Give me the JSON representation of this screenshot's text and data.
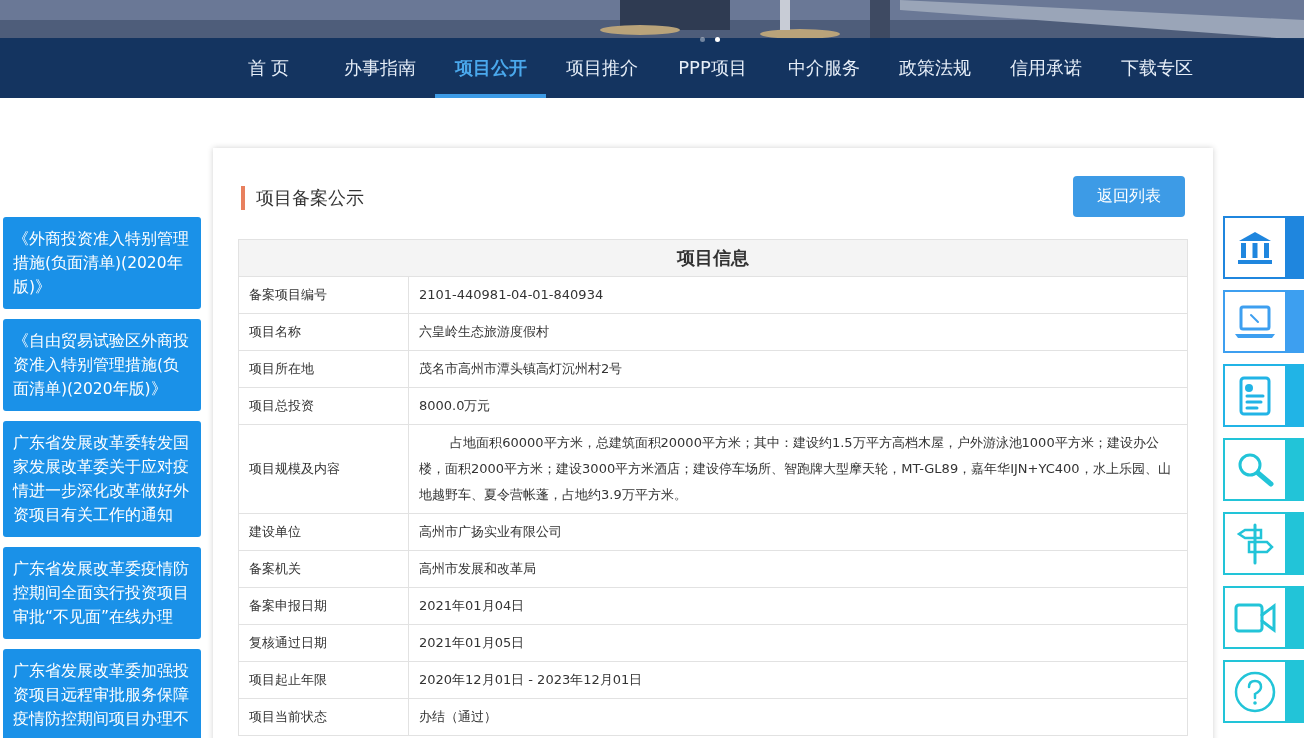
{
  "banner": {
    "kind": "picture",
    "slides": [
      {
        "selected": false
      },
      {
        "selected": true
      }
    ]
  },
  "nav": [
    {
      "label": "首 页",
      "selected": false
    },
    {
      "label": "办事指南",
      "selected": false
    },
    {
      "label": "项目公开",
      "selected": true
    },
    {
      "label": "项目推介",
      "selected": false
    },
    {
      "label": "PPP项目",
      "selected": false
    },
    {
      "label": "中介服务",
      "selected": false
    },
    {
      "label": "政策法规",
      "selected": false
    },
    {
      "label": "信用承诺",
      "selected": false
    },
    {
      "label": "下载专区",
      "selected": false
    }
  ],
  "left_links": [
    "《外商投资准入特别管理措施(负面清单)(2020年版)》",
    "《自由贸易试验区外商投资准入特别管理措施(负面清单)(2020年版)》",
    "广东省发展改革委转发国家发展改革委关于应对疫情进一步深化改革做好外资项目有关工作的通知",
    "广东省发展改革委疫情防控期间全面实行投资项目审批“不见面”在线办理",
    "广东省发展改革委加强投资项目远程审批服务保障疫情防控期间项目办理不"
  ],
  "panel": {
    "title": "项目备案公示",
    "back_button": "返回列表",
    "table": {
      "heading": "项目信息",
      "rows": [
        {
          "label": "备案项目编号",
          "value": "2101-440981-04-01-840934"
        },
        {
          "label": "项目名称",
          "value": "六皇岭生态旅游度假村"
        },
        {
          "label": "项目所在地",
          "value": "茂名市高州市潭头镇高灯沉州村2号"
        },
        {
          "label": "项目总投资",
          "value": "8000.0万元"
        },
        {
          "label": "项目规模及内容",
          "value": "占地面积60000平方米，总建筑面积20000平方米；其中：建设约1.5万平方高档木屋，户外游泳池1000平方米；建设办公楼，面积2000平方米；建设3000平方米酒店；建设停车场所、智跑牌大型摩天轮，MT-GL89，嘉年华IJN+YC400，水上乐园、山地越野车、夏令营帐蓬，占地约3.9万平方米。",
          "indent": true
        },
        {
          "label": "建设单位",
          "value": "高州市广扬实业有限公司"
        },
        {
          "label": "备案机关",
          "value": "高州市发展和改革局"
        },
        {
          "label": "备案申报日期",
          "value": "2021年01月04日"
        },
        {
          "label": "复核通过日期",
          "value": "2021年01月05日"
        },
        {
          "label": "项目起止年限",
          "value": "2020年12月01日 - 2023年12月01日"
        },
        {
          "label": "项目当前状态",
          "value": "办结（通过）"
        }
      ]
    }
  },
  "right_tiles": [
    {
      "kind": "building",
      "color": "#1f86de"
    },
    {
      "kind": "laptop",
      "color": "#3d9ff0"
    },
    {
      "kind": "document",
      "color": "#21b4e6"
    },
    {
      "kind": "search",
      "color": "#22c4d8"
    },
    {
      "kind": "signpost",
      "color": "#22c4d8"
    },
    {
      "kind": "camera",
      "color": "#22c4d8"
    },
    {
      "kind": "question",
      "color": "#22c4d8"
    }
  ]
}
